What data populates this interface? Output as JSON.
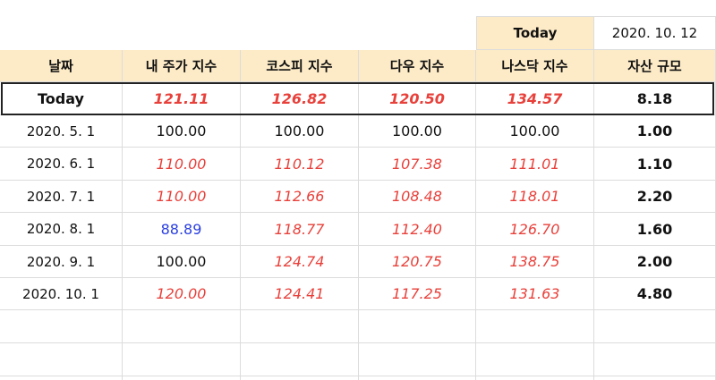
{
  "today_box": {
    "label": "Today",
    "date": "2020. 10. 12"
  },
  "columns": [
    "날짜",
    "내 주가 지수",
    "코스피 지수",
    "다우 지수",
    "나스닥 지수",
    "자산 규모"
  ],
  "today_row": {
    "label": "Today",
    "values": [
      "121.11",
      "126.82",
      "120.50",
      "134.57",
      "8.18"
    ]
  },
  "rows": [
    {
      "date": "2020. 5. 1",
      "values": [
        "100.00",
        "100.00",
        "100.00",
        "100.00",
        "1.00"
      ]
    },
    {
      "date": "2020. 6. 1",
      "values": [
        "110.00",
        "110.12",
        "107.38",
        "111.01",
        "1.10"
      ]
    },
    {
      "date": "2020. 7. 1",
      "values": [
        "110.00",
        "112.66",
        "108.48",
        "118.01",
        "2.20"
      ]
    },
    {
      "date": "2020. 8. 1",
      "values": [
        "88.89",
        "118.77",
        "112.40",
        "126.70",
        "1.60"
      ]
    },
    {
      "date": "2020. 9. 1",
      "values": [
        "100.00",
        "124.74",
        "120.75",
        "138.75",
        "2.00"
      ]
    },
    {
      "date": "2020. 10. 1",
      "values": [
        "120.00",
        "124.41",
        "117.25",
        "131.63",
        "4.80"
      ]
    }
  ],
  "colors": {
    "up": "#e8403a",
    "down": "#2a3fe0",
    "neutral": "#111111",
    "header_bg": "#fdebc7"
  }
}
